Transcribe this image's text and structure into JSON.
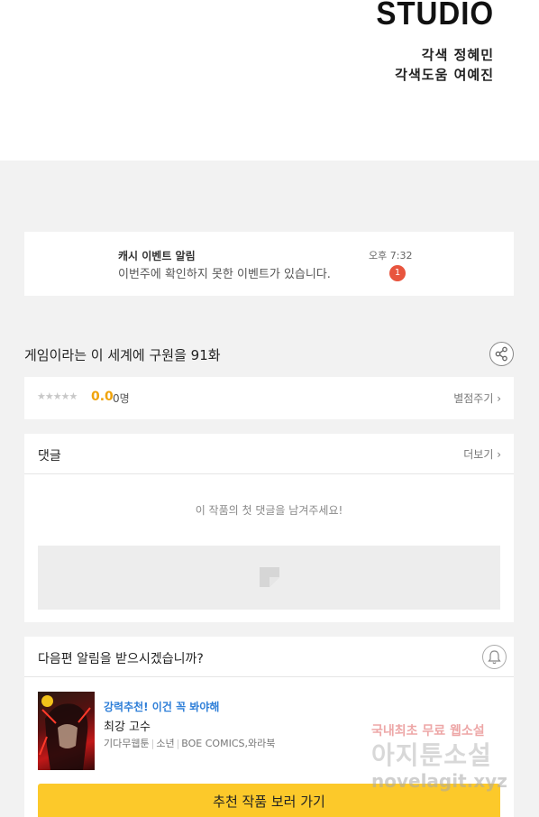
{
  "credits": {
    "studio": "STUDIO",
    "line1": "각색 정혜민",
    "line2": "각색도움 여예진"
  },
  "notice": {
    "title": "캐시 이벤트 알림",
    "text": "이번주에 확인하지 못한 이벤트가 있습니다.",
    "time": "오후 7:32",
    "badge": "1"
  },
  "episode": {
    "title": "게임이라는 이 세계에 구원을 91화",
    "share_icon": "share-icon"
  },
  "rating": {
    "stars": "★★★★★",
    "score": "0.0",
    "raters": "0명",
    "rate_link": "별점주기 ›"
  },
  "comments": {
    "title": "댓글",
    "more": "더보기 ›",
    "empty": "이 작품의 첫 댓글을 남겨주세요!"
  },
  "alarm": {
    "title": "다음편 알림을 받으시겠습니까?",
    "bell_icon": "bell-icon"
  },
  "recommend": {
    "tag": "강력추천! 이건 꼭 봐야해",
    "title": "최강 고수",
    "genre1": "기다무웹툰",
    "genre2": "소년",
    "publisher": "BOE COMICS,와라북",
    "button": "추천 작품 보러 가기"
  },
  "watermark": {
    "line1": "국내최초 무료 웹소설",
    "line2": "아지툰소설",
    "line3": "novelagit.xyz"
  },
  "colors": {
    "accent_yellow": "#fcc92a",
    "badge_red": "#e8553e",
    "score_orange": "#f0a30a",
    "tag_blue": "#2f7fd8"
  }
}
